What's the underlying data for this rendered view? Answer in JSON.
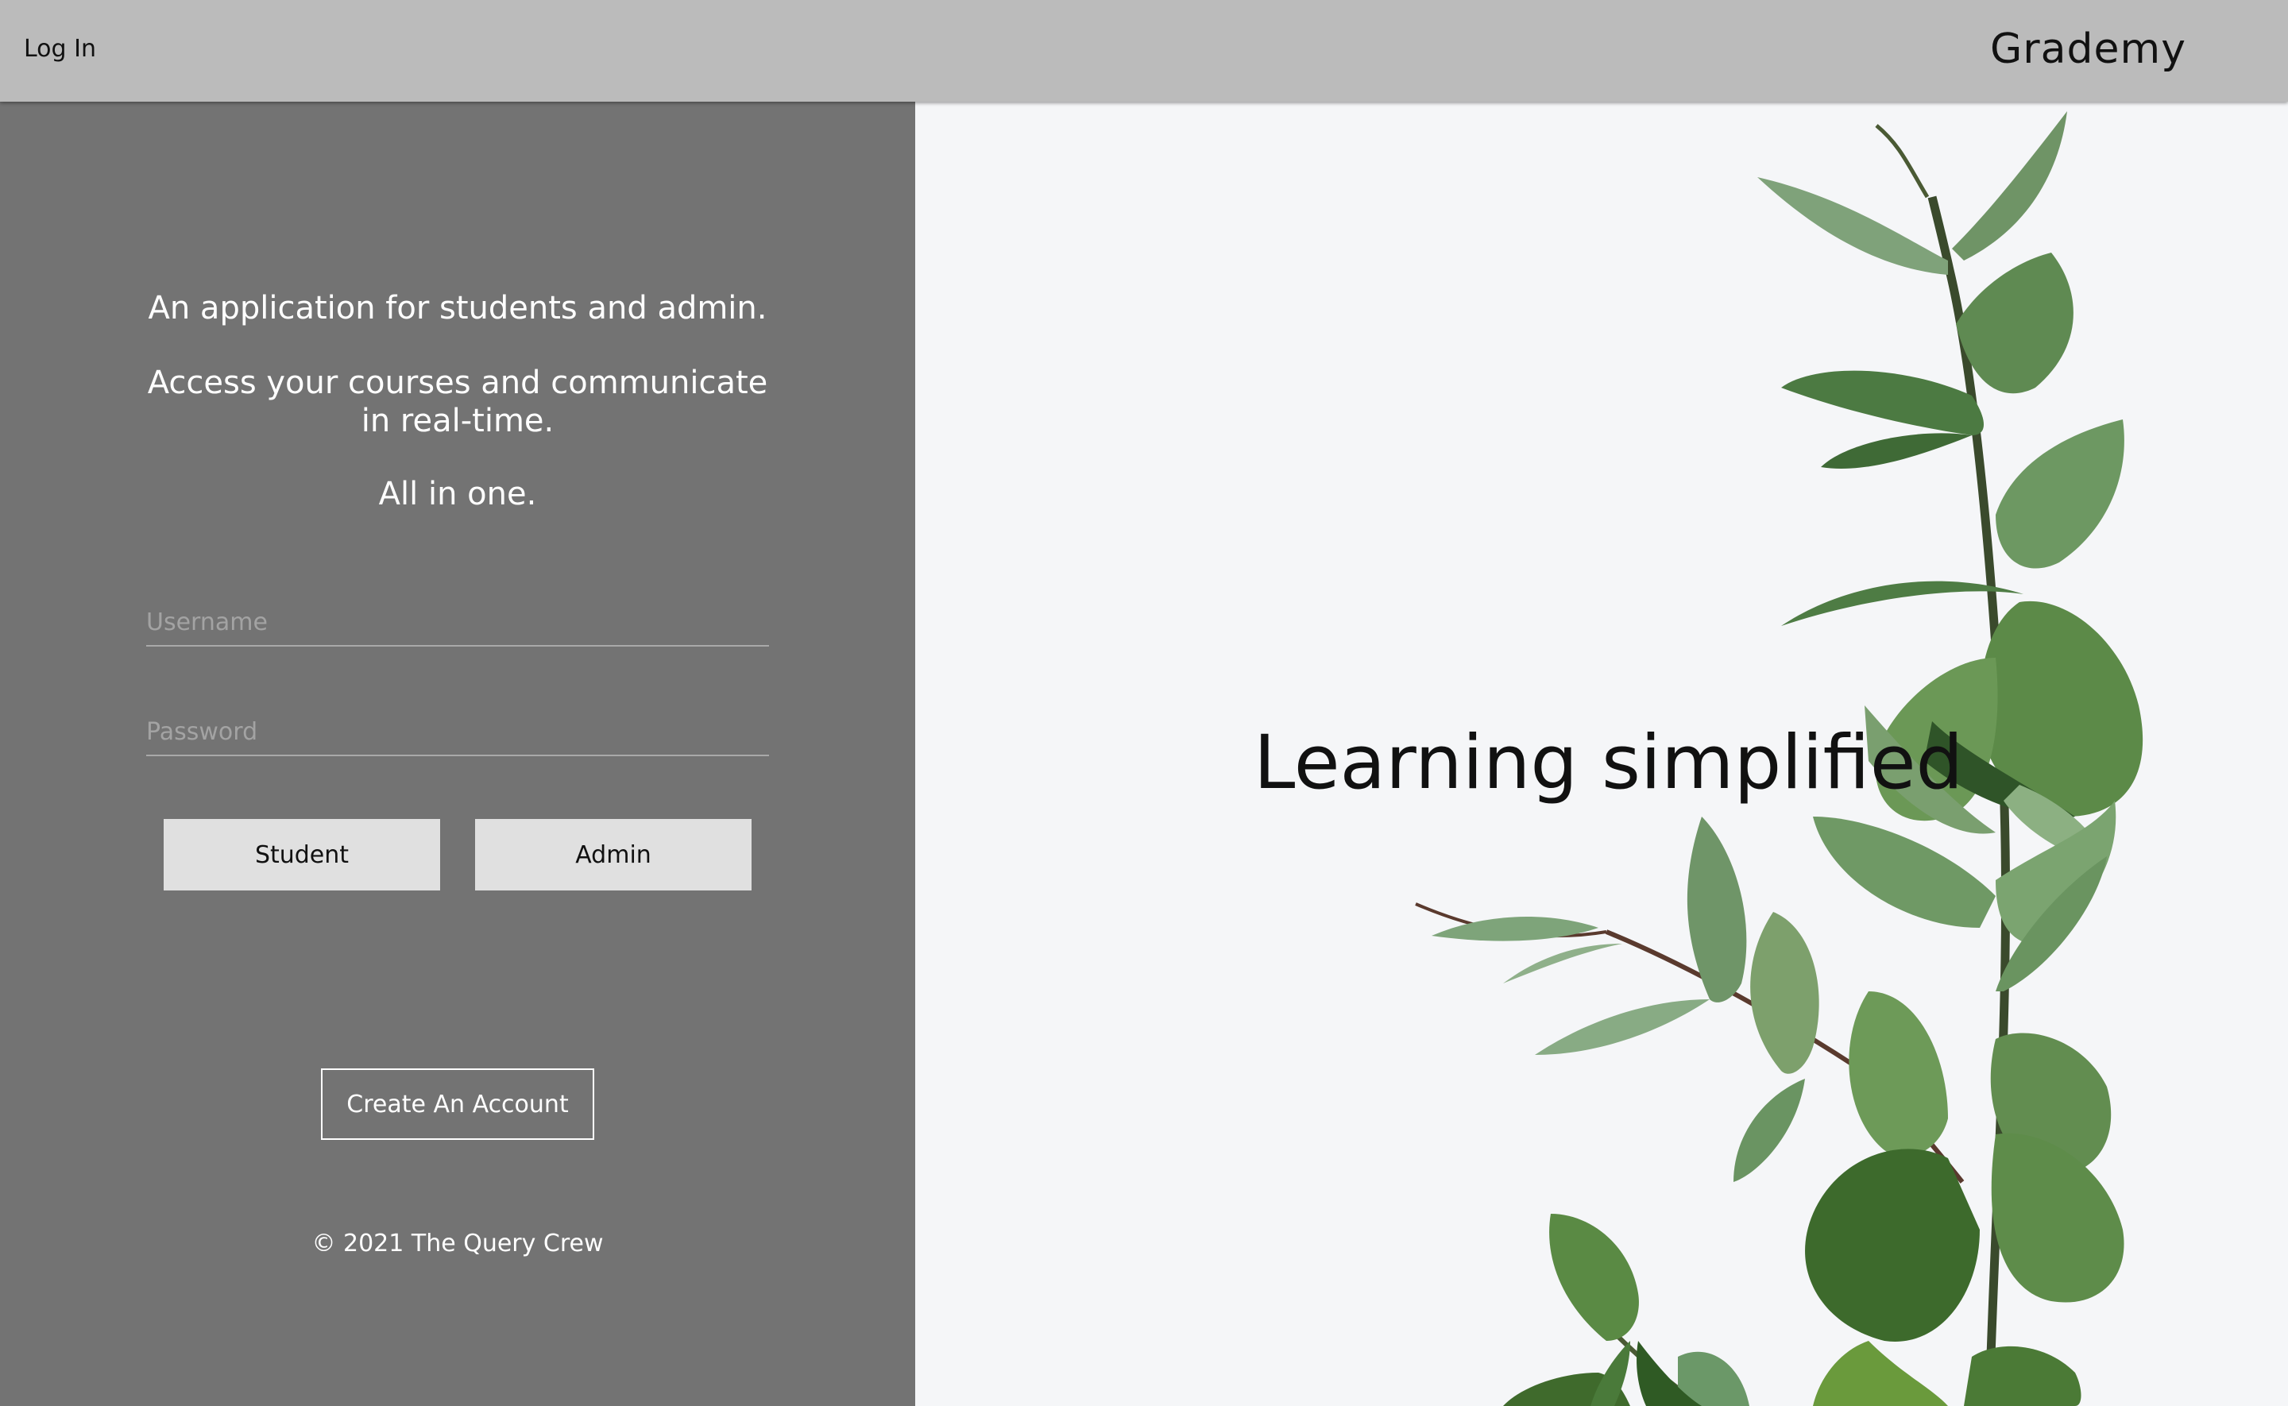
{
  "header": {
    "login_label": "Log In",
    "brand": "Grademy"
  },
  "left": {
    "tagline_1": "An application for students and admin.",
    "tagline_2": "Access your courses and communicate in real-time.",
    "tagline_3": "All in one.",
    "username_placeholder": "Username",
    "password_placeholder": "Password",
    "student_button": "Student",
    "admin_button": "Admin",
    "create_account_button": "Create An Account",
    "footer": "© 2021 The Query Crew"
  },
  "hero": {
    "headline": "Learning simplified"
  },
  "colors": {
    "topbar": "#bbbbbb",
    "left_panel": "#737373",
    "right_panel": "#f5f6f8",
    "button": "#e0e0e0",
    "leaf_dark": "#3f6a36",
    "leaf_light": "#8fb08a"
  },
  "images": {
    "hero_image": "eucalyptus-branch-photo"
  }
}
